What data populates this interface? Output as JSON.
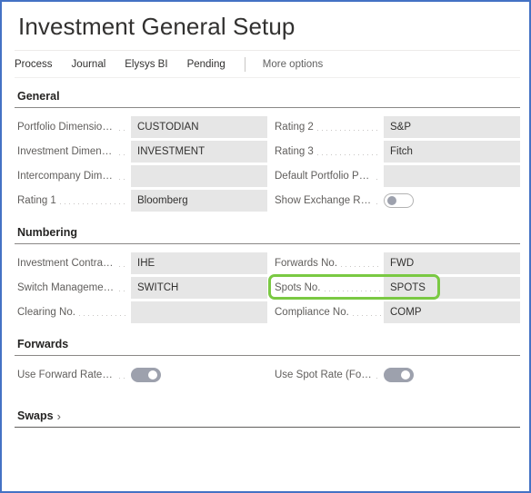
{
  "header": {
    "title": "Investment General Setup"
  },
  "actionbar": {
    "items": [
      {
        "label": "Process"
      },
      {
        "label": "Journal"
      },
      {
        "label": "Elysys BI"
      },
      {
        "label": "Pending"
      }
    ],
    "more_options": "More options"
  },
  "colors": {
    "window_border": "#4472c4",
    "highlight": "#7ac943",
    "field_background": "#e6e6e6",
    "toggle_on": "#9da1ad",
    "label_text": "#605e5c",
    "value_text": "#323130"
  },
  "sections": [
    {
      "title": "General",
      "collapsed": false,
      "left": [
        {
          "label": "Portfolio Dimension ...",
          "value": "CUSTODIAN",
          "type": "text"
        },
        {
          "label": "Investment Dimensio...",
          "value": "INVESTMENT",
          "type": "text"
        },
        {
          "label": "Intercompany Dimen...",
          "value": "",
          "type": "text"
        },
        {
          "label": "Rating 1",
          "value": "Bloomberg",
          "type": "text"
        }
      ],
      "right": [
        {
          "label": "Rating 2",
          "value": "S&P",
          "type": "text"
        },
        {
          "label": "Rating 3",
          "value": "Fitch",
          "type": "text"
        },
        {
          "label": "Default Portfolio Pos....",
          "value": "",
          "type": "text"
        },
        {
          "label": "Show Exchange Rate...",
          "value": "off",
          "type": "toggle"
        }
      ]
    },
    {
      "title": "Numbering",
      "collapsed": false,
      "left": [
        {
          "label": "Investment Contracts...",
          "value": "IHE",
          "type": "text"
        },
        {
          "label": "Switch Management ...",
          "value": "SWITCH",
          "type": "text"
        },
        {
          "label": "Clearing No.",
          "value": "",
          "type": "text"
        }
      ],
      "right": [
        {
          "label": "Forwards No.",
          "value": "FWD",
          "type": "text"
        },
        {
          "label": "Spots No.",
          "value": "SPOTS",
          "type": "text",
          "highlighted": true
        },
        {
          "label": "Compliance No.",
          "value": "COMP",
          "type": "text"
        }
      ]
    },
    {
      "title": "Forwards",
      "collapsed": false,
      "left": [
        {
          "label": "Use Forward Rate (M...",
          "value": "on",
          "type": "toggle"
        }
      ],
      "right": [
        {
          "label": "Use Spot Rate (Forex ...",
          "value": "on",
          "type": "toggle"
        }
      ]
    },
    {
      "title": "Swaps",
      "collapsed": true,
      "chevron": "›",
      "left": [],
      "right": []
    }
  ]
}
